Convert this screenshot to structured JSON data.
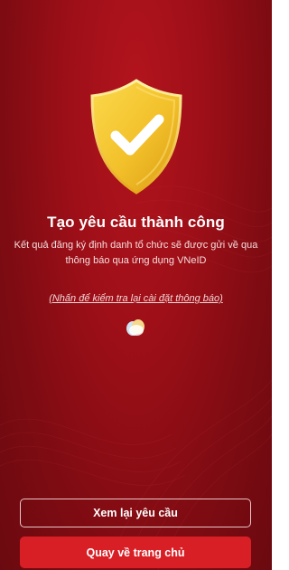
{
  "result": {
    "title": "Tạo yêu cầu thành công",
    "message": "Kết quả đăng ký định danh tổ chức sẽ được gửi về qua thông báo qua ứng dụng VNeID",
    "settings_link": "(Nhấn để kiểm tra lại cài đặt thông báo)"
  },
  "actions": {
    "review_label": "Xem lại yêu cầu",
    "home_label": "Quay về trang chủ"
  },
  "icons": {
    "status": "shield-check-icon",
    "loading": "loading-icon"
  },
  "colors": {
    "background": "#9e0f18",
    "shield": "#f2c02a",
    "primary_button": "#d81f26",
    "text": "#ffffff"
  }
}
